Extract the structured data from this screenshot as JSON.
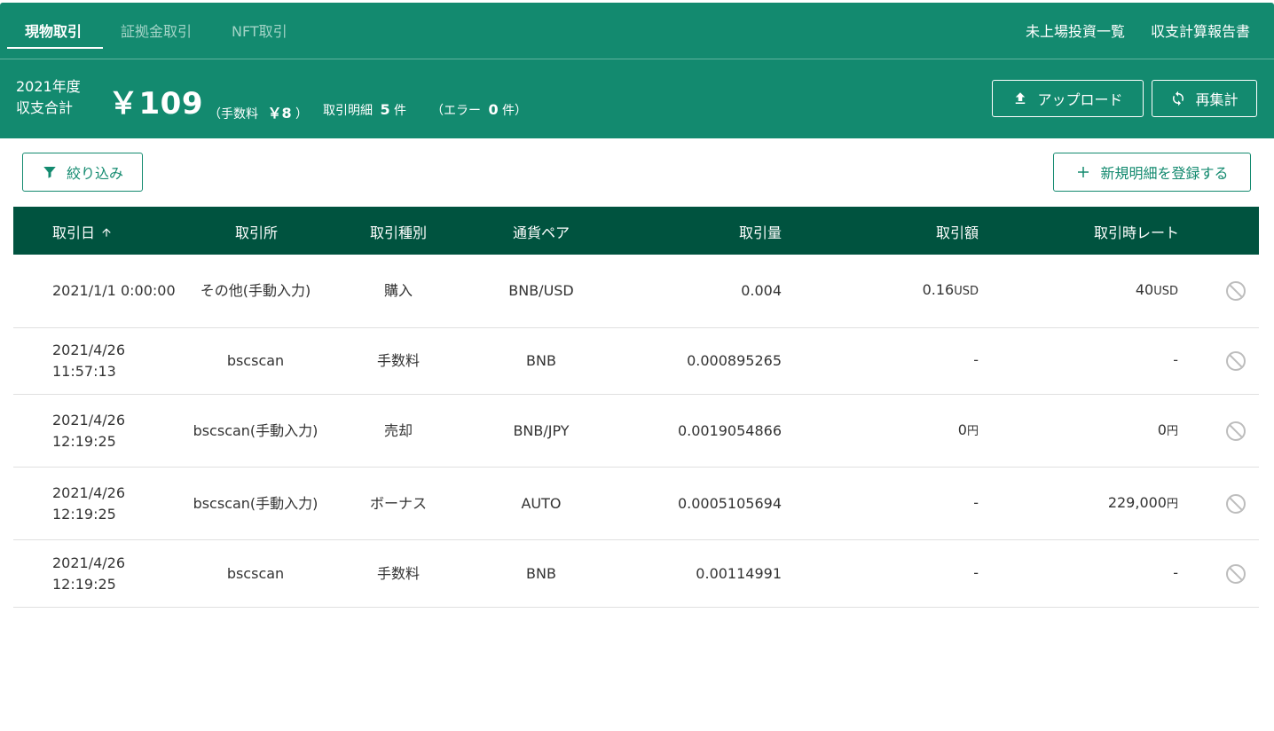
{
  "nav": {
    "tabs": [
      {
        "label": "現物取引",
        "active": true
      },
      {
        "label": "証拠金取引",
        "active": false
      },
      {
        "label": "NFT取引",
        "active": false
      }
    ],
    "links": [
      "未上場投資一覧",
      "収支計算報告書"
    ]
  },
  "summary": {
    "year": "2021年度",
    "total_label": "収支合計",
    "total": "￥109",
    "fee_prefix": "（手数料",
    "fee_value": "￥8",
    "fee_suffix": "）",
    "count_label": "取引明細",
    "count_value": "5",
    "count_unit": "件",
    "error_prefix": "（エラー",
    "error_value": "0",
    "error_suffix": "件）",
    "upload_label": "アップロード",
    "recalc_label": "再集計"
  },
  "actions": {
    "filter_label": "絞り込み",
    "add_label": "新規明細を登録する"
  },
  "table": {
    "headers": {
      "date": "取引日",
      "exchange": "取引所",
      "type": "取引種別",
      "pair": "通貨ペア",
      "qty": "取引量",
      "amount": "取引額",
      "rate": "取引時レート"
    },
    "rows": [
      {
        "date": "2021/1/1 0:00:00",
        "exchange": "その他(手動入力)",
        "type": "購入",
        "pair": "BNB/USD",
        "qty": "0.004",
        "amount": "0.16",
        "amount_unit": "USD",
        "rate": "40",
        "rate_unit": "USD"
      },
      {
        "date": "2021/4/26 11:57:13",
        "exchange": "bscscan",
        "type": "手数料",
        "pair": "BNB",
        "qty": "0.000895265",
        "amount": "-",
        "amount_unit": "",
        "rate": "-",
        "rate_unit": ""
      },
      {
        "date": "2021/4/26 12:19:25",
        "exchange": "bscscan(手動入力)",
        "type": "売却",
        "pair": "BNB/JPY",
        "qty": "0.0019054866",
        "amount": "0",
        "amount_unit": "円",
        "rate": "0",
        "rate_unit": "円"
      },
      {
        "date": "2021/4/26 12:19:25",
        "exchange": "bscscan(手動入力)",
        "type": "ボーナス",
        "pair": "AUTO",
        "qty": "0.0005105694",
        "amount": "-",
        "amount_unit": "",
        "rate": "229,000",
        "rate_unit": "円"
      },
      {
        "date": "2021/4/26 12:19:25",
        "exchange": "bscscan",
        "type": "手数料",
        "pair": "BNB",
        "qty": "0.00114991",
        "amount": "-",
        "amount_unit": "",
        "rate": "-",
        "rate_unit": ""
      }
    ]
  },
  "colors": {
    "primary": "#138a6f",
    "header_dark": "#00533f"
  }
}
